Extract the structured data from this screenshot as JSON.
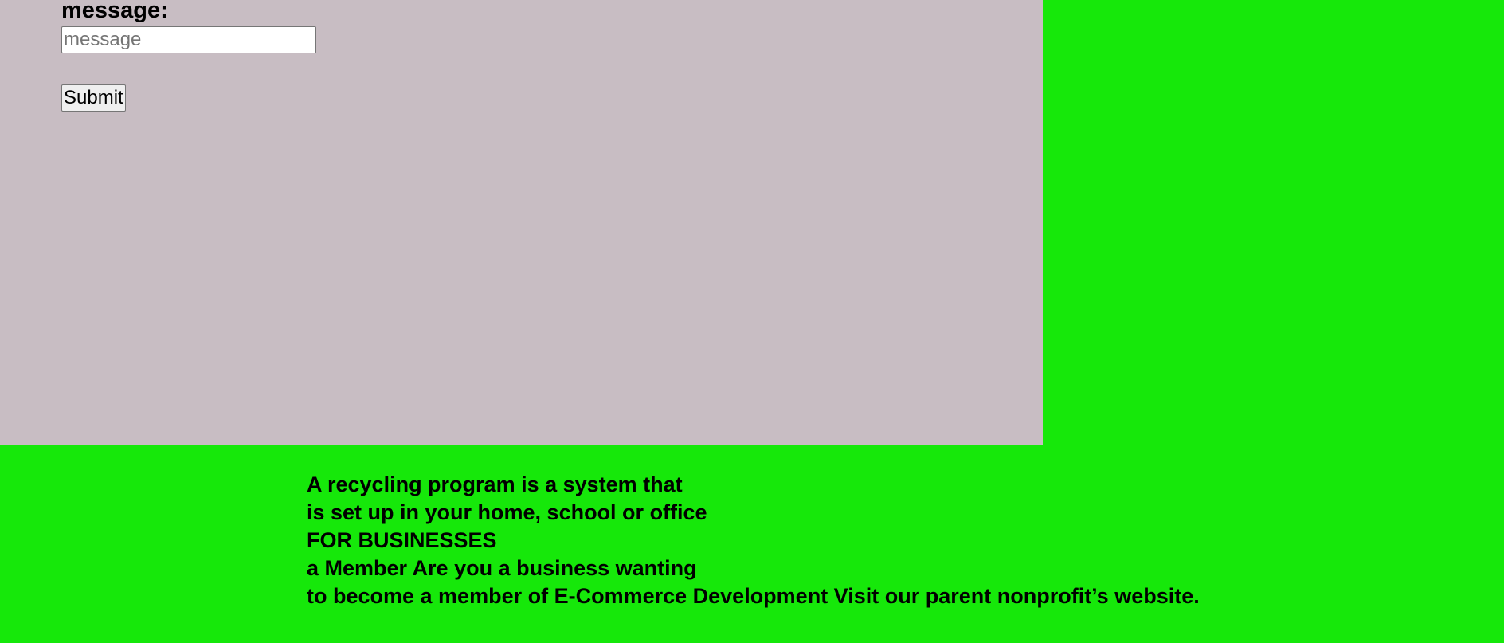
{
  "contact_form": {
    "message_label": "message:",
    "message_placeholder": "message",
    "message_value": "",
    "submit_label": "Submit"
  },
  "footer": {
    "lines": [
      "A recycling program is a system that",
      "is set up in your home, school or office",
      "FOR BUSINESSES",
      "a Member Are you a business wanting",
      "to become a member of E-Commerce Development Visit our parent nonprofit’s website."
    ]
  },
  "colors": {
    "page_background": "#16e80a",
    "form_panel_background": "#c8bdc3"
  }
}
